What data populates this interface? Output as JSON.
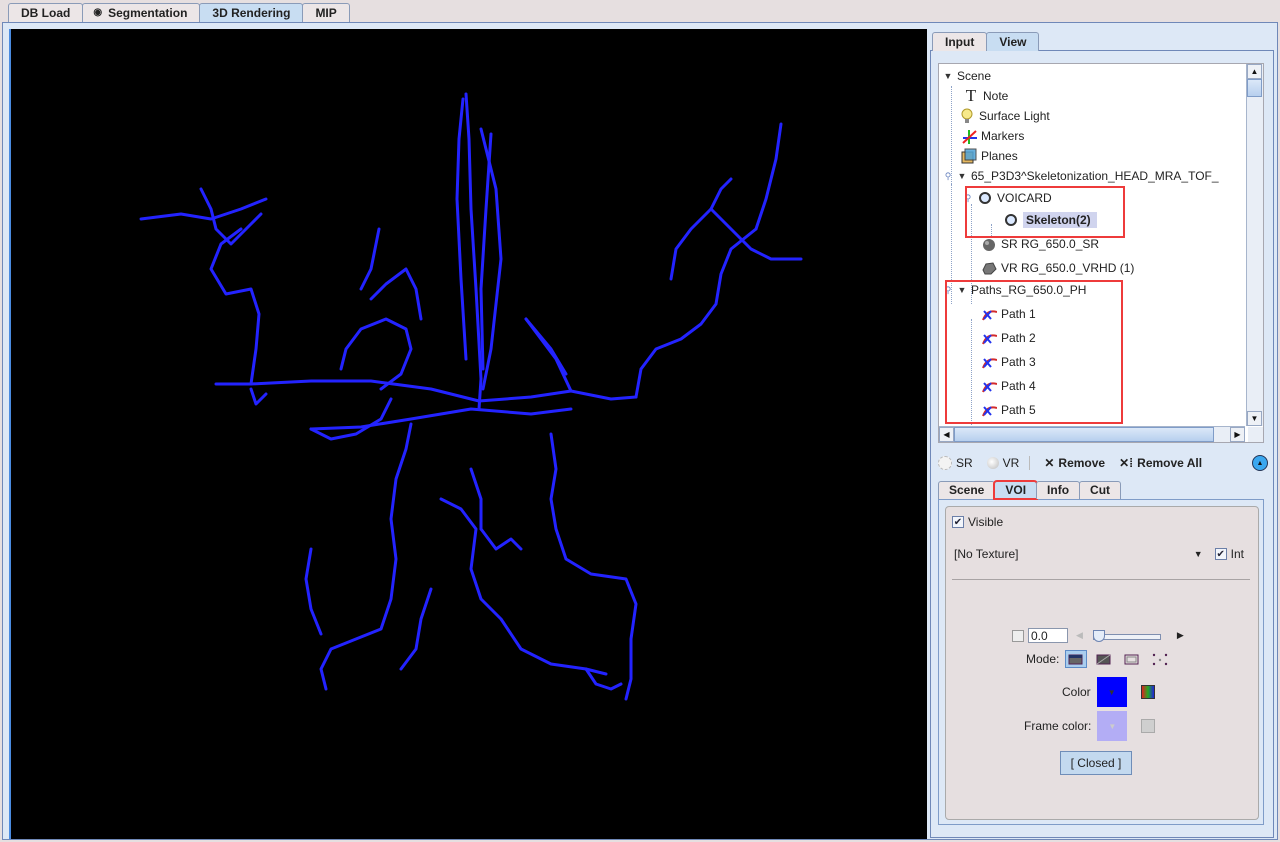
{
  "main_tabs": [
    {
      "label": "DB Load",
      "active": false
    },
    {
      "label": "Segmentation",
      "active": false,
      "icon": "radio-dot-icon"
    },
    {
      "label": "3D Rendering",
      "active": true
    },
    {
      "label": "MIP",
      "active": false
    }
  ],
  "viewport": {
    "background": "#000000",
    "vessel_color": "#2323ff",
    "content": "3D skeleton rendering of head vessels"
  },
  "side_tabs": [
    {
      "label": "Input",
      "active": false
    },
    {
      "label": "View",
      "active": true
    }
  ],
  "tree": {
    "nodes": [
      {
        "label": "Scene",
        "icon": "expand-triangle-icon"
      },
      {
        "label": "Note",
        "icon": "text-T-icon"
      },
      {
        "label": "Surface Light",
        "icon": "light-bulb-icon"
      },
      {
        "label": "Markers",
        "icon": "markers-axes-icon"
      },
      {
        "label": "Planes",
        "icon": "planes-cube-icon"
      },
      {
        "label": "65_P3D3^Skeletonization_HEAD_MRA_TOF_",
        "icon": "expand-triangle-icon"
      },
      {
        "label": "VOICARD",
        "icon": "voi-icon"
      },
      {
        "label": "Skeleton(2)",
        "icon": "voi-icon",
        "selected": true
      },
      {
        "label": "SR RG_650.0_SR",
        "icon": "surface-render-icon"
      },
      {
        "label": "VR RG_650.0_VRHD (1)",
        "icon": "volume-render-icon"
      },
      {
        "label": "Paths_RG_650.0_PH",
        "icon": "expand-triangle-icon"
      },
      {
        "label": "Path 1",
        "icon": "path-icon"
      },
      {
        "label": "Path 2",
        "icon": "path-icon"
      },
      {
        "label": "Path 3",
        "icon": "path-icon"
      },
      {
        "label": "Path 4",
        "icon": "path-icon"
      },
      {
        "label": "Path 5",
        "icon": "path-icon"
      }
    ]
  },
  "toolbar": {
    "sr_label": "SR",
    "vr_label": "VR",
    "remove_label": "Remove",
    "remove_all_label": "Remove All"
  },
  "lower_tabs": [
    {
      "label": "Scene",
      "active": false
    },
    {
      "label": "VOI",
      "active": true
    },
    {
      "label": "Info",
      "active": false
    },
    {
      "label": "Cut",
      "active": false
    }
  ],
  "voi_panel": {
    "visible_label": "Visible",
    "visible_checked": true,
    "texture_value": "[No Texture]",
    "int_label": "Int",
    "int_checked": true,
    "transparency_checked": false,
    "transparency_value": "0.0",
    "slider_fraction": 0.0,
    "mode_label": "Mode:",
    "modes": [
      "solid-mode",
      "shaded-mode",
      "wireframe-mode",
      "points-mode"
    ],
    "active_mode": 0,
    "color_label": "Color",
    "color": "#0000ff",
    "frame_color_label": "Frame color:",
    "frame_color": "#b3adf5",
    "closed_button": "[ Closed ]"
  },
  "highlight_color": "#ee3b3b"
}
